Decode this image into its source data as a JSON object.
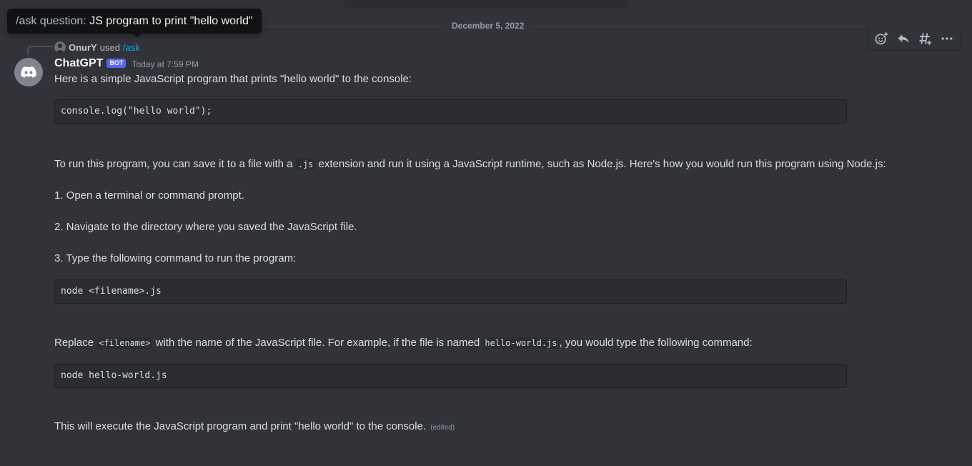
{
  "date_divider": "December 5, 2022",
  "tooltip": {
    "prefix": "/ask question:",
    "value": "JS program to print \"hello world\""
  },
  "reply": {
    "username": "OnurY",
    "used_text": "used",
    "command": "/ask"
  },
  "message": {
    "author": "ChatGPT",
    "badge": "BOT",
    "timestamp": "Today at 7:59 PM",
    "intro": "Here is a simple JavaScript program that prints \"hello world\" to the console:",
    "code1": "console.log(\"hello world\");",
    "run_para": {
      "before": "To run this program, you can save it to a file with a",
      "code": ".js",
      "after": "extension and run it using a JavaScript runtime, such as Node.js. Here's how you would run this program using Node.js:"
    },
    "step1": "1. Open a terminal or command prompt.",
    "step2": "2. Navigate to the directory where you saved the JavaScript file.",
    "step3": "3. Type the following command to run the program:",
    "code2": "node <filename>.js",
    "replace_para": {
      "before": "Replace",
      "code1": "<filename>",
      "middle": "with the name of the JavaScript file. For example, if the file is named",
      "code2": "hello-world.js",
      "after": ", you would type the following command:"
    },
    "code3": "node hello-world.js",
    "closing": "This will execute the JavaScript program and print \"hello world\" to the console.",
    "edited": "(edited)"
  },
  "toolbar": {
    "icons": [
      "add-reaction-icon",
      "reply-icon",
      "create-thread-icon",
      "more-icon"
    ]
  },
  "colors": {
    "background": "#323339",
    "bot_badge": "#5865f2",
    "command_link": "#00a8fc",
    "code_background": "#2b2d31"
  }
}
